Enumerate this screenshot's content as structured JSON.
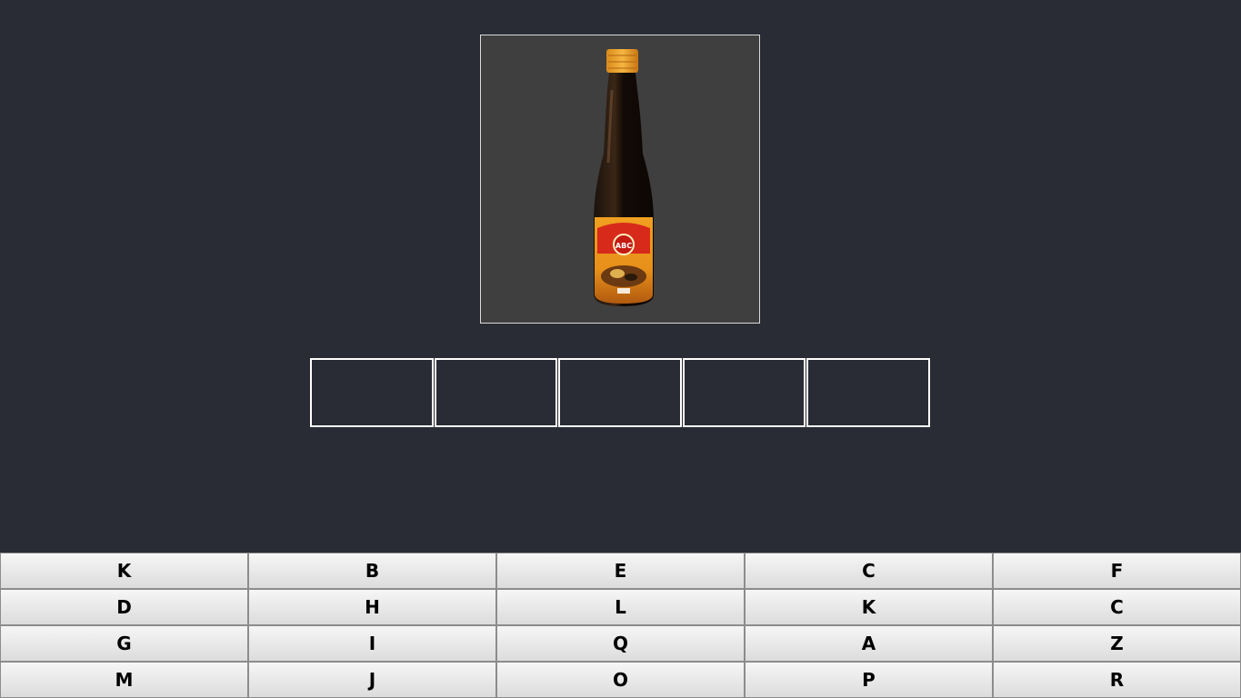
{
  "clue": {
    "image_name": "soy-sauce-bottle",
    "bottle_label_brand": "ABC"
  },
  "answer": {
    "slots": [
      "",
      "",
      "",
      "",
      ""
    ]
  },
  "keyboard": {
    "keys": [
      "K",
      "B",
      "E",
      "C",
      "F",
      "D",
      "H",
      "L",
      "K",
      "C",
      "G",
      "I",
      "Q",
      "A",
      "Z",
      "M",
      "J",
      "O",
      "P",
      "R"
    ]
  },
  "colors": {
    "background": "#292c35",
    "picture_bg": "#3f3f3f",
    "slot_border": "#ffffff",
    "key_face": "#e8e8e8"
  }
}
